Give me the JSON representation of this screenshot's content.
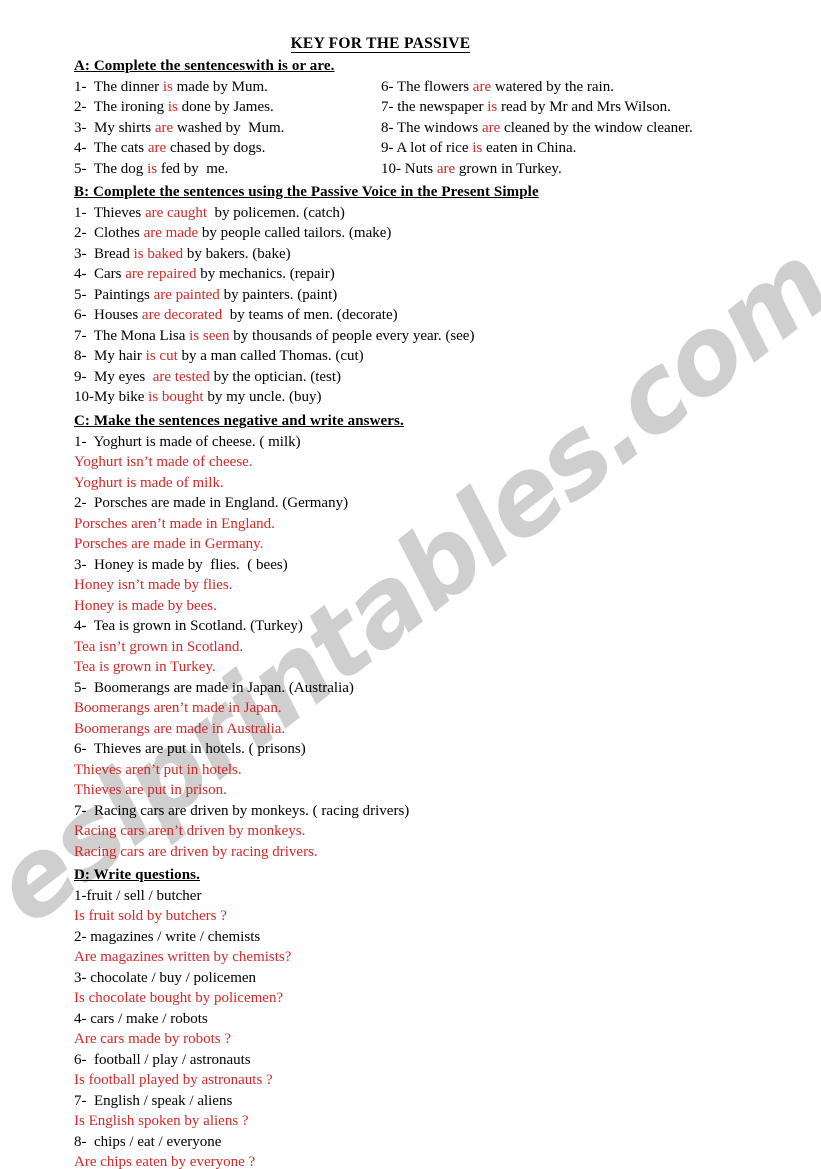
{
  "document": {
    "title": "KEY FOR THE PASSIVE",
    "watermark": "eslprintables.com",
    "answer_color": "#cf2a2a",
    "text_color": "#000000",
    "background_color": "#ffffff"
  },
  "sections": {
    "a": {
      "heading": "A:  Complete the sentenceswith  is or are.",
      "left": [
        {
          "num": "1-  ",
          "pre": "The dinner ",
          "ans": "is",
          "post": " made by Mum."
        },
        {
          "num": "2-  ",
          "pre": "The ironing ",
          "ans": "is",
          "post": " done by James."
        },
        {
          "num": "3-  ",
          "pre": "My shirts ",
          "ans": "are",
          "post": " washed by  Mum."
        },
        {
          "num": "4-  ",
          "pre": "The cats ",
          "ans": "are",
          "post": " chased by dogs."
        },
        {
          "num": "5-  ",
          "pre": "The dog ",
          "ans": "is",
          "post": " fed by  me."
        }
      ],
      "right": [
        {
          "num": "6- ",
          "pre": "The flowers ",
          "ans": "are",
          "post": " watered by the rain."
        },
        {
          "num": "7- ",
          "pre": "the newspaper ",
          "ans": "is",
          "post": " read by Mr and Mrs Wilson."
        },
        {
          "num": "8- ",
          "pre": "The windows ",
          "ans": "are",
          "post": " cleaned by the window cleaner."
        },
        {
          "num": "9- ",
          "pre": "A lot of rice ",
          "ans": "is",
          "post": " eaten in China."
        },
        {
          "num": "10- ",
          "pre": "Nuts ",
          "ans": "are",
          "post": " grown in Turkey."
        }
      ]
    },
    "b": {
      "heading": "B:  Complete the sentences using the Passive Voice in the Present  Simple",
      "items": [
        {
          "num": "1-  ",
          "pre": "Thieves ",
          "ans": "are caught",
          "post": "  by policemen. (catch)"
        },
        {
          "num": "2-  ",
          "pre": "Clothes ",
          "ans": "are made",
          "post": " by people called tailors. (make)"
        },
        {
          "num": "3-  ",
          "pre": "Bread ",
          "ans": "is baked",
          "post": " by bakers. (bake)"
        },
        {
          "num": "4-  ",
          "pre": "Cars ",
          "ans": "are repaired",
          "post": " by mechanics. (repair)"
        },
        {
          "num": "5-  ",
          "pre": "Paintings ",
          "ans": "are painted",
          "post": " by painters. (paint)"
        },
        {
          "num": "6-  ",
          "pre": "Houses ",
          "ans": "are decorated",
          "post": "  by teams of men. (decorate)"
        },
        {
          "num": "7-  ",
          "pre": "The Mona Lisa ",
          "ans": "is seen",
          "post": " by thousands of people every year. (see)"
        },
        {
          "num": "8-  ",
          "pre": "My hair ",
          "ans": "is cut",
          "post": " by a man called Thomas. (cut)"
        },
        {
          "num": "9-  ",
          "pre": "My eyes  ",
          "ans": "are tested",
          "post": " by the optician. (test)"
        },
        {
          "num": "10-",
          "pre": "My bike ",
          "ans": "is bought",
          "post": " by my uncle. (buy)"
        }
      ]
    },
    "c": {
      "heading": "C: Make the sentences negative and write answers.",
      "items": [
        {
          "prompt": "1-  Yoghurt is made of cheese. ( milk)",
          "answers": [
            "Yoghurt isn’t made of cheese.",
            "Yoghurt is made of milk."
          ]
        },
        {
          "prompt": "2-  Porsches are made in England. (Germany)",
          "answers": [
            "Porsches aren’t made in England.",
            "Porsches are made in Germany."
          ]
        },
        {
          "prompt": "3-  Honey is made by  flies.  ( bees)",
          "answers": [
            "Honey isn’t made by flies.",
            "Honey is made by bees."
          ]
        },
        {
          "prompt": "4-  Tea is grown in Scotland. (Turkey)",
          "answers": [
            "Tea isn’t grown in Scotland.",
            "Tea is grown in Turkey."
          ]
        },
        {
          "prompt": "5-  Boomerangs are made in Japan. (Australia)",
          "answers": [
            "Boomerangs aren’t made in Japan.",
            "Boomerangs are made in Australia."
          ]
        },
        {
          "prompt": "6-  Thieves are put in hotels. ( prisons)",
          "answers": [
            "Thieves aren’t put in hotels.",
            "Thieves are put in prison."
          ]
        },
        {
          "prompt": "7-  Racing cars are driven by monkeys. ( racing drivers)",
          "answers": [
            "Racing cars aren’t driven by monkeys.",
            "Racing cars are driven by racing drivers."
          ]
        }
      ]
    },
    "d": {
      "heading": "D:  Write questions.",
      "items": [
        {
          "prompt": "1-fruit / sell / butcher",
          "answer": "Is fruit sold by butchers ?"
        },
        {
          "prompt": "2- magazines / write / chemists",
          "answer": "Are magazines written by chemists?"
        },
        {
          "prompt": "3- chocolate / buy / policemen",
          "answer": "Is chocolate bought by policemen?"
        },
        {
          "prompt": "4- cars / make / robots",
          "answer": "Are cars made by robots ?"
        },
        {
          "prompt": "6-  football / play / astronauts",
          "answer": "Is football played by astronauts ?"
        },
        {
          "prompt": "7-  English / speak / aliens",
          "answer": "Is English spoken by aliens ?"
        },
        {
          "prompt": "8-  chips / eat / everyone",
          "answer": "Are chips eaten by everyone ?"
        }
      ]
    }
  }
}
